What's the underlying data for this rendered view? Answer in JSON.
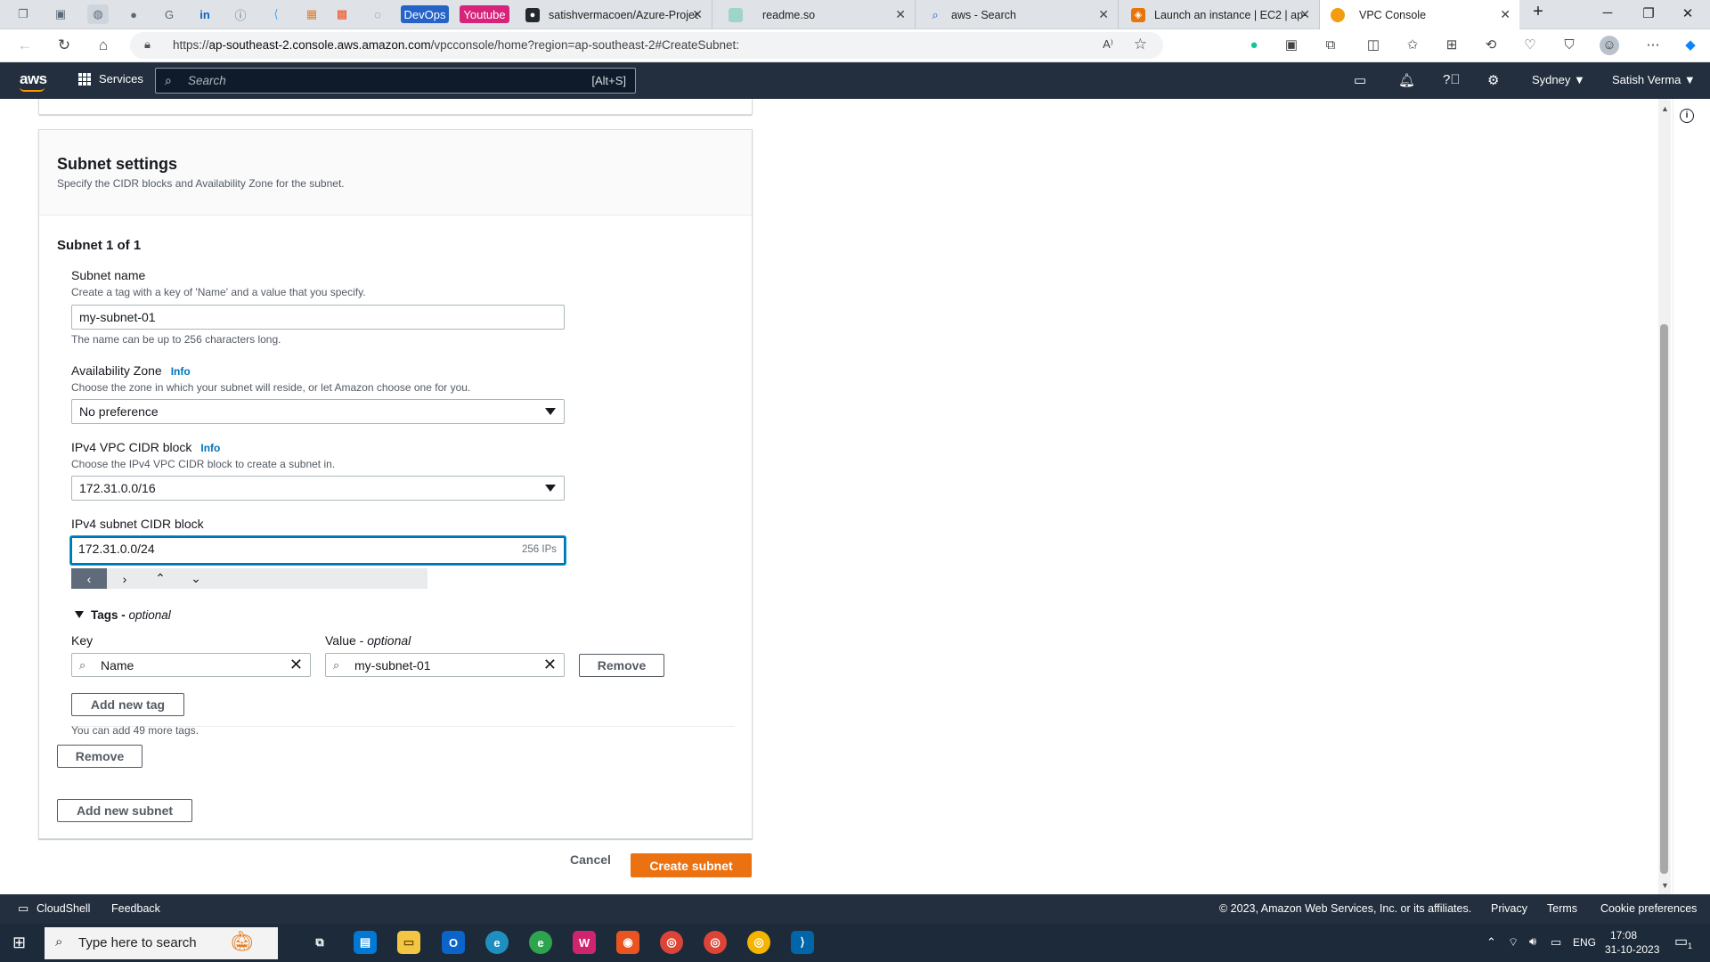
{
  "browser": {
    "pinned": [
      {
        "name": "pinned-tab-icon"
      },
      {
        "name": "github-icon"
      },
      {
        "name": "google-icon"
      },
      {
        "name": "linkedin-icon"
      },
      {
        "name": "info-icon"
      },
      {
        "name": "flutter-icon"
      },
      {
        "name": "pinned-tab-icon"
      },
      {
        "name": "microsoft-icon"
      },
      {
        "name": "pinned-tab-icon"
      }
    ],
    "pinned_labels": {
      "devops": "DevOps",
      "youtube": "Youtube"
    },
    "tabs": [
      {
        "title": "satishvermacoen/Azure-Projec",
        "icon": "github-icon"
      },
      {
        "title": "readme.so",
        "icon": "readme-icon"
      },
      {
        "title": "aws - Search",
        "icon": "search-icon"
      },
      {
        "title": "Launch an instance | EC2 | ap-",
        "icon": "aws-icon"
      },
      {
        "title": "VPC Console",
        "icon": "aws-icon"
      }
    ],
    "url_prefix": "https://",
    "url_host": "ap-southeast-2.console.aws.amazon.com",
    "url_rest": "/vpcconsole/home?region=ap-southeast-2#CreateSubnet:"
  },
  "aws_nav": {
    "logo": "aws",
    "services": "Services",
    "search_placeholder": "Search",
    "search_shortcut": "[Alt+S]",
    "region": "Sydney ▼",
    "user": "Satish Verma ▼"
  },
  "subnet_settings": {
    "title": "Subnet settings",
    "description": "Specify the CIDR blocks and Availability Zone for the subnet.",
    "subnet_heading": "Subnet 1 of 1",
    "name": {
      "label": "Subnet name",
      "description": "Create a tag with a key of 'Name' and a value that you specify.",
      "value": "my-subnet-01",
      "constraint": "The name can be up to 256 characters long."
    },
    "az": {
      "label": "Availability Zone",
      "info": "Info",
      "description": "Choose the zone in which your subnet will reside, or let Amazon choose one for you.",
      "value": "No preference"
    },
    "vpc_cidr": {
      "label": "IPv4 VPC CIDR block",
      "info": "Info",
      "description": "Choose the IPv4 VPC CIDR block to create a subnet in.",
      "value": "172.31.0.0/16"
    },
    "subnet_cidr": {
      "label": "IPv4 subnet CIDR block",
      "value": "172.31.0.0/24",
      "suffix": "256 IPs"
    },
    "stepper": [
      "‹",
      "›",
      "⌃",
      "⌄"
    ],
    "tags": {
      "toggle": "Tags - ",
      "toggle_optional": "optional",
      "key_label": "Key",
      "value_label": "Value - ",
      "value_optional": "optional",
      "key_value": "Name",
      "value_value": "my-subnet-01",
      "remove": "Remove",
      "add": "Add new tag",
      "limit": "You can add 49 more tags."
    },
    "remove_subnet": "Remove",
    "add_subnet": "Add new subnet"
  },
  "actions": {
    "cancel": "Cancel",
    "create": "Create subnet"
  },
  "footer": {
    "cloudshell": "CloudShell",
    "feedback": "Feedback",
    "copyright": "© 2023, Amazon Web Services, Inc. or its affiliates.",
    "privacy": "Privacy",
    "terms": "Terms",
    "cookies": "Cookie preferences"
  },
  "taskbar": {
    "search_placeholder": "Type here to search",
    "lang": "ENG",
    "time": "17:08",
    "date": "31-10-2023",
    "notification_count": "1"
  },
  "colors": {
    "aws_nav": "#232f3e",
    "primary_button": "#ec7211",
    "link": "#0073bb"
  }
}
